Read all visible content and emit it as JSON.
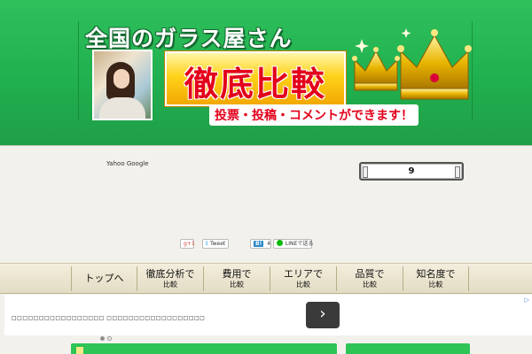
{
  "banner": {
    "title": "全国のガラス屋さん",
    "headline": "徹底比較",
    "subtitle": "投票・投稿・コメントができます！"
  },
  "search": {
    "label": "Yahoo Google"
  },
  "counter": {
    "value": "9"
  },
  "social": {
    "gplus": "g+1",
    "tweet_icon": "𝕥",
    "tweet": "Tweet",
    "hatena_icon": "B!",
    "hatena_count": "4",
    "line": "LINEで送る"
  },
  "nav": {
    "items": [
      {
        "l1": "トップへ",
        "l2": ""
      },
      {
        "l1": "徹底分析で",
        "l2": "比較"
      },
      {
        "l1": "費用で",
        "l2": "比較"
      },
      {
        "l1": "エリアで",
        "l2": "比較"
      },
      {
        "l1": "品質で",
        "l2": "比較"
      },
      {
        "l1": "知名度で",
        "l2": "比較"
      }
    ]
  },
  "ad": {
    "text": "□□□□□□□□□□□□□□□□□ □□□□□□□□□□□□□□□□□□",
    "arrow": "›",
    "corner": "▷"
  },
  "colors": {
    "header_green": "#21b04f",
    "accent_red": "#e3001b",
    "gold": "#ffd21a"
  }
}
